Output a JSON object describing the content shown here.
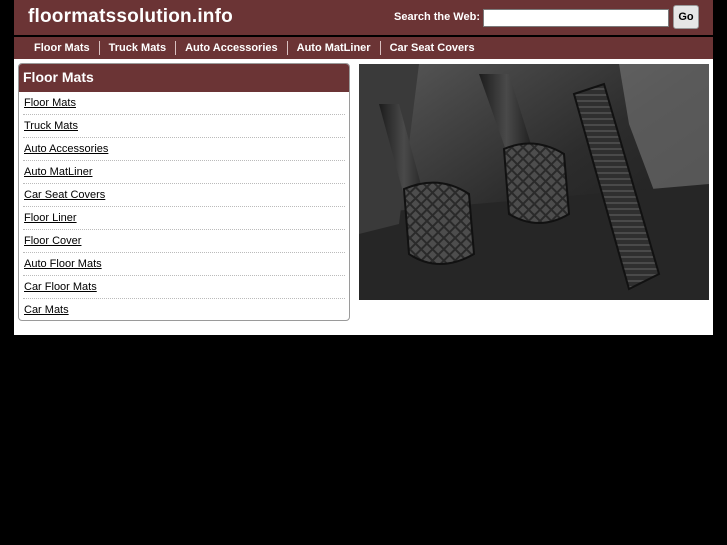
{
  "header": {
    "site_title": "floormatssolution.info",
    "search_label": "Search the Web:",
    "search_value": "",
    "go_label": "Go"
  },
  "nav": {
    "items": [
      "Floor Mats",
      "Truck Mats",
      "Auto Accessories",
      "Auto MatLiner",
      "Car Seat Covers"
    ]
  },
  "sidebar": {
    "title": "Floor Mats",
    "links": [
      "Floor Mats",
      "Truck Mats",
      "Auto Accessories",
      "Auto MatLiner",
      "Car Seat Covers",
      "Floor Liner",
      "Floor Cover",
      "Auto Floor Mats",
      "Car Floor Mats",
      "Car Mats"
    ]
  },
  "colors": {
    "brand": "#6b3435",
    "background": "#000000",
    "content_bg": "#ffffff"
  }
}
